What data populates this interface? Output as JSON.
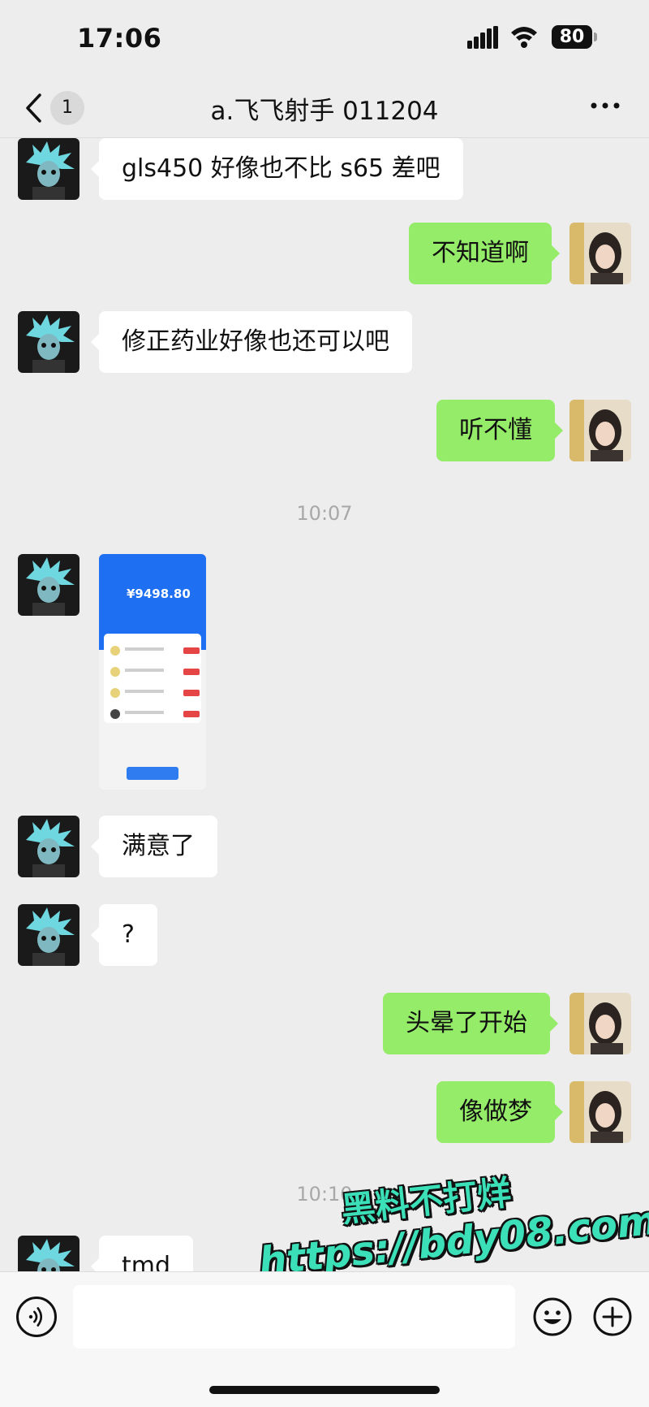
{
  "status_bar": {
    "time": "17:06",
    "battery": "80"
  },
  "nav": {
    "back_icon": "chevron-left-icon",
    "unread_count": "1",
    "title": "a.飞飞射手 011204",
    "more_icon": "more-horizontal-icon"
  },
  "messages": [
    {
      "side": "in",
      "text": "gls450 好像也不比 s65 差吧"
    },
    {
      "side": "out",
      "text": "不知道啊"
    },
    {
      "side": "in",
      "text": "修正药业好像也还可以吧"
    },
    {
      "side": "out",
      "text": "听不懂"
    },
    {
      "type": "time",
      "text": "10:07"
    },
    {
      "side": "in",
      "type": "image",
      "amount": "¥9498.80"
    },
    {
      "side": "in",
      "text": "满意了"
    },
    {
      "side": "in",
      "text": "?"
    },
    {
      "side": "out",
      "text": "头晕了开始"
    },
    {
      "side": "out",
      "text": "像做梦"
    },
    {
      "type": "time",
      "text": "10:10"
    },
    {
      "side": "in",
      "text": "tmd"
    }
  ],
  "watermark": {
    "line1": "黑料不打烊",
    "line2": "https://bdy08.com"
  },
  "input_bar": {
    "voice_icon": "voice-icon",
    "emoji_icon": "emoji-icon",
    "plus_icon": "plus-icon",
    "placeholder": ""
  },
  "colors": {
    "background": "#ededed",
    "outgoing_bubble": "#95ec69",
    "incoming_bubble": "#ffffff",
    "watermark": "#3be0b8"
  }
}
